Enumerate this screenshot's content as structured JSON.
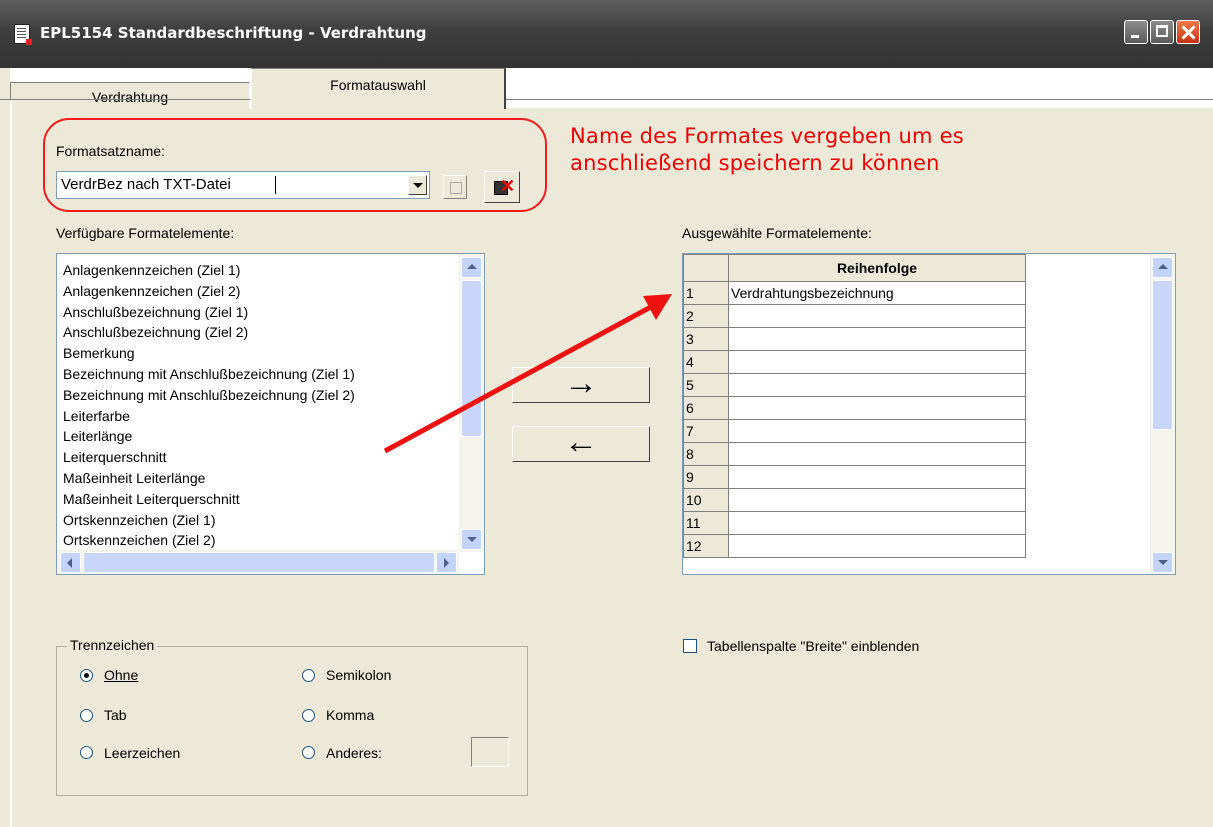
{
  "window": {
    "title": "EPL5154 Standardbeschriftung - Verdrahtung",
    "colors": {
      "titlebar": "#3e3e3e",
      "face": "#ece9d8",
      "annotation": "#ee1111"
    }
  },
  "tabs": [
    {
      "label": "Verdrahtung",
      "active": false
    },
    {
      "label": "Formatauswahl",
      "active": true
    }
  ],
  "format": {
    "label": "Formatsatzname:",
    "value": "VerdrBez nach TXT-Datei"
  },
  "annotation": {
    "line1": "Name des Formates vergeben um es",
    "line2": "anschließend speichern zu können"
  },
  "available": {
    "label": "Verfügbare Formatelemente:",
    "items": [
      "Anlagenkennzeichen (Ziel 1)",
      "Anlagenkennzeichen (Ziel 2)",
      "Anschlußbezeichnung (Ziel 1)",
      "Anschlußbezeichnung (Ziel 2)",
      "Bemerkung",
      "Bezeichnung mit Anschlußbezeichnung (Ziel 1)",
      "Bezeichnung mit Anschlußbezeichnung (Ziel 2)",
      "Leiterfarbe",
      "Leiterlänge",
      "Leiterquerschnitt",
      "Maßeinheit Leiterlänge",
      "Maßeinheit Leiterquerschnitt",
      "Ortskennzeichen (Ziel 1)",
      "Ortskennzeichen (Ziel 2)"
    ]
  },
  "move": {
    "add_icon": "→",
    "remove_icon": "←"
  },
  "selected": {
    "label": "Ausgewählte Formatelemente:",
    "column_header": "Reihenfolge",
    "rows": [
      {
        "num": "1",
        "value": "Verdrahtungsbezeichnung"
      },
      {
        "num": "2",
        "value": ""
      },
      {
        "num": "3",
        "value": ""
      },
      {
        "num": "4",
        "value": ""
      },
      {
        "num": "5",
        "value": ""
      },
      {
        "num": "6",
        "value": ""
      },
      {
        "num": "7",
        "value": ""
      },
      {
        "num": "8",
        "value": ""
      },
      {
        "num": "9",
        "value": ""
      },
      {
        "num": "10",
        "value": ""
      },
      {
        "num": "11",
        "value": ""
      },
      {
        "num": "12",
        "value": ""
      }
    ]
  },
  "width_checkbox": {
    "label": "Tabellenspalte \"Breite\" einblenden",
    "checked": false
  },
  "separator": {
    "title": "Trennzeichen",
    "options": [
      {
        "label": "Ohne",
        "checked": true
      },
      {
        "label": "Tab",
        "checked": false
      },
      {
        "label": "Leerzeichen",
        "checked": false
      },
      {
        "label": "Semikolon",
        "checked": false
      },
      {
        "label": "Komma",
        "checked": false
      },
      {
        "label": "Anderes:",
        "checked": false
      }
    ]
  }
}
